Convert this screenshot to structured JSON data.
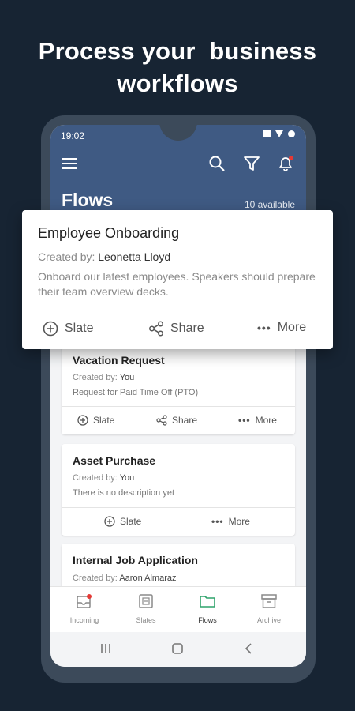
{
  "headline": {
    "line1": "Process your  business",
    "line2": "workflows"
  },
  "status_bar": {
    "time": "19:02"
  },
  "appbar": {
    "title": "Flows",
    "available": "10 available"
  },
  "featured_card": {
    "title": "Employee Onboarding",
    "created_label": "Created by:",
    "created_by": "Leonetta Lloyd",
    "description": "Onboard our latest employees. Speakers should prepare their team overview decks.",
    "actions": {
      "slate": "Slate",
      "share": "Share",
      "more": "More"
    }
  },
  "cards": [
    {
      "title": "Vacation Request",
      "created_label": "Created by:",
      "created_by": "You",
      "description": "Request for Paid Time Off (PTO)",
      "actions": {
        "slate": "Slate",
        "share": "Share",
        "more": "More"
      }
    },
    {
      "title": "Asset Purchase",
      "created_label": "Created by:",
      "created_by": "You",
      "description": "There is no description yet",
      "actions": {
        "slate": "Slate",
        "more": "More"
      }
    },
    {
      "title": "Internal Job Application",
      "created_label": "Created by:",
      "created_by": "Aaron Almaraz"
    }
  ],
  "bottom_nav": [
    {
      "label": "Incoming",
      "icon": "incoming-icon",
      "active": false,
      "badge": true
    },
    {
      "label": "Slates",
      "icon": "slates-icon",
      "active": false
    },
    {
      "label": "Flows",
      "icon": "flows-folder-icon",
      "active": true
    },
    {
      "label": "Archive",
      "icon": "archive-icon",
      "active": false
    }
  ],
  "colors": {
    "background": "#172433",
    "appbar": "#3f5a83",
    "active_nav": "#2fa36b",
    "badge": "#e53935"
  }
}
